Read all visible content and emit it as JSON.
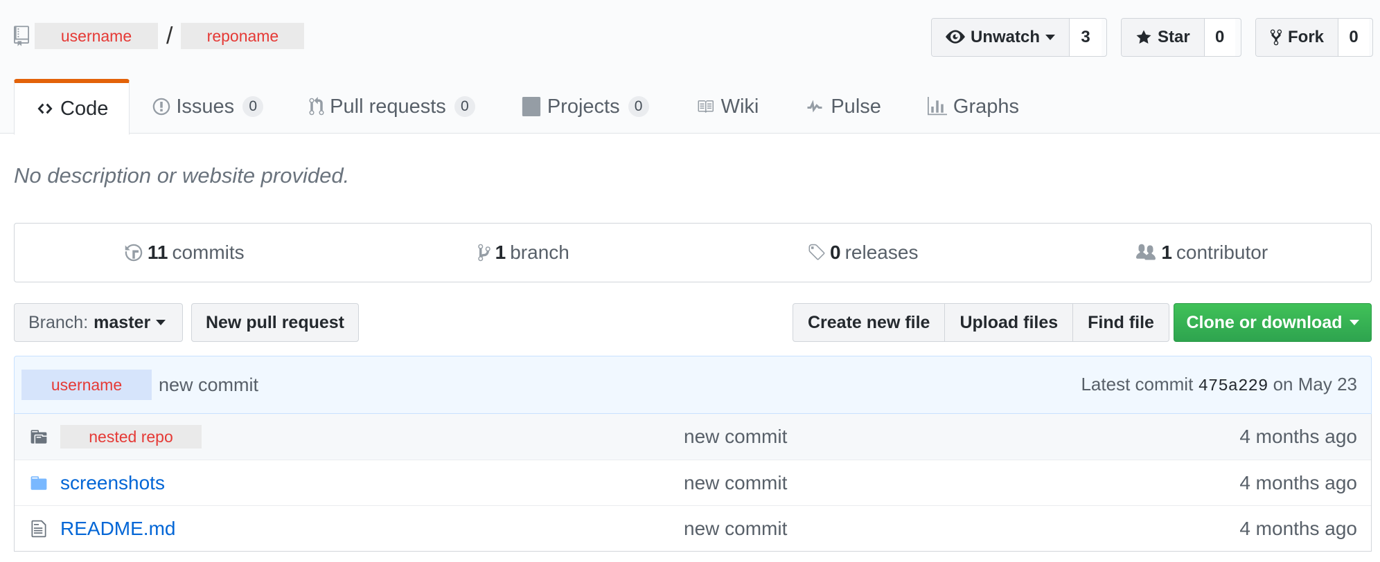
{
  "repo": {
    "owner": "username",
    "separator": "/",
    "name": "reponame",
    "icon": "repo-icon"
  },
  "actions": {
    "watch": {
      "label": "Unwatch",
      "count": "3",
      "icon": "eye-icon"
    },
    "star": {
      "label": "Star",
      "count": "0",
      "icon": "star-icon"
    },
    "fork": {
      "label": "Fork",
      "count": "0",
      "icon": "repo-forked-icon"
    }
  },
  "tabs": [
    {
      "label": "Code",
      "icon": "code-icon",
      "selected": true
    },
    {
      "label": "Issues",
      "count": "0",
      "icon": "issue-opened-icon"
    },
    {
      "label": "Pull requests",
      "count": "0",
      "icon": "git-pull-request-icon"
    },
    {
      "label": "Projects",
      "count": "0",
      "icon": "project-icon"
    },
    {
      "label": "Wiki",
      "icon": "book-icon"
    },
    {
      "label": "Pulse",
      "icon": "pulse-icon"
    },
    {
      "label": "Graphs",
      "icon": "graph-icon"
    }
  ],
  "description": "No description or website provided.",
  "summary": {
    "commits": {
      "num": "11",
      "label": "commits",
      "icon": "history-icon"
    },
    "branches": {
      "num": "1",
      "label": "branch",
      "icon": "git-branch-icon"
    },
    "releases": {
      "num": "0",
      "label": "releases",
      "icon": "tag-icon"
    },
    "contributors": {
      "num": "1",
      "label": "contributor",
      "icon": "organization-icon"
    }
  },
  "file_nav": {
    "branch_prefix": "Branch:",
    "branch_name": "master",
    "new_pull_request": "New pull request",
    "create_new_file": "Create new file",
    "upload_files": "Upload files",
    "find_file": "Find file",
    "clone_or_download": "Clone or download"
  },
  "commit_tease": {
    "author": "username",
    "message": "new commit",
    "latest_prefix": "Latest commit",
    "sha": "475a229",
    "date": "on May 23"
  },
  "files": [
    {
      "name": "nested repo",
      "type": "submodule",
      "icon": "file-submodule-icon",
      "message": "new commit",
      "age": "4 months ago"
    },
    {
      "name": "screenshots",
      "type": "directory",
      "icon": "folder-icon",
      "message": "new commit",
      "age": "4 months ago"
    },
    {
      "name": "README.md",
      "type": "file",
      "icon": "file-text-icon",
      "message": "new commit",
      "age": "4 months ago"
    }
  ],
  "colors": {
    "selected_tab_accent": "#e36209",
    "clone_button": "#2ea44f",
    "link": "#0366d6",
    "placeholder_text": "#e53935"
  }
}
